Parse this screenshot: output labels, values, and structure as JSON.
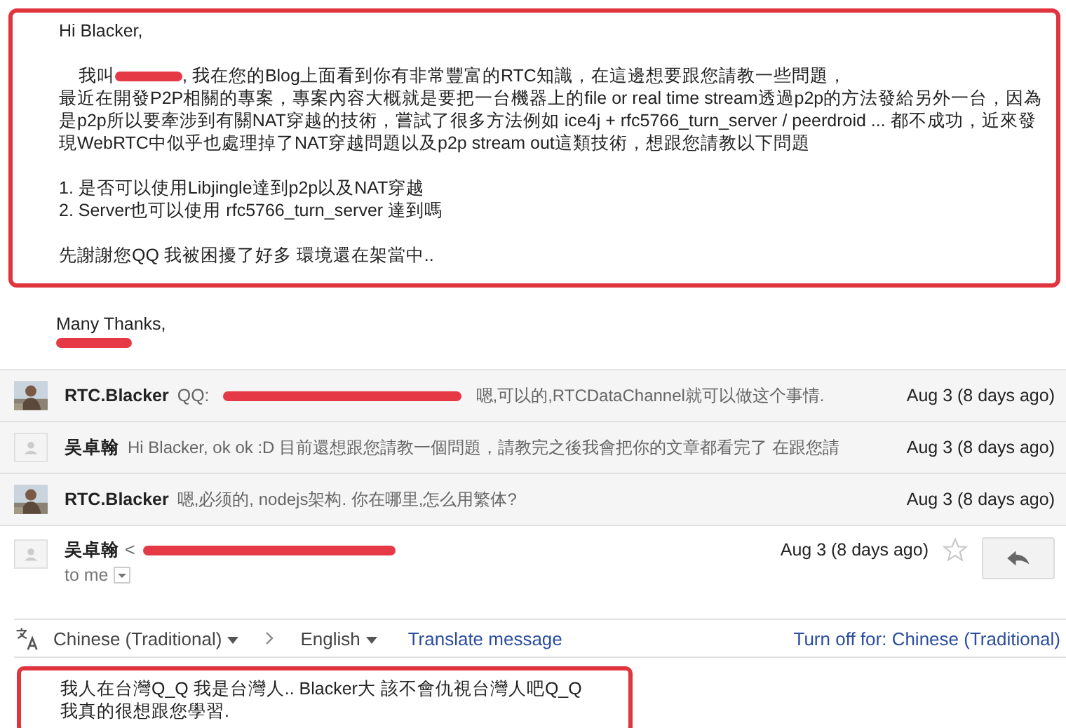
{
  "quoted_message": {
    "highlighted": true,
    "greeting": "Hi Blacker,",
    "intro_before": "我叫",
    "intro_redacted": true,
    "intro_after": ", 我在您的Blog上面看到你有非常豐富的RTC知識，在這邊想要跟您請教一些問題，",
    "paragraph": "最近在開發P2P相關的專案，專案內容大概就是要把一台機器上的file or real time stream透過p2p的方法發給另外一台，因為是p2p所以要牽涉到有關NAT穿越的技術，嘗試了很多方法例如 ice4j + rfc5766_turn_server / peerdroid ... 都不成功，近來發現WebRTC中似乎也處理掉了NAT穿越問題以及p2p stream out這類技術，想跟您請教以下問題",
    "questions": [
      "1. 是否可以使用Libjingle達到p2p以及NAT穿越",
      "2. Server也可以使用 rfc5766_turn_server 達到嗎"
    ],
    "closing": "先謝謝您QQ 我被困擾了好多 環境還在架當中.."
  },
  "signature": {
    "text": "Many Thanks,",
    "name_redacted": true
  },
  "thread": [
    {
      "sender": "RTC.Blacker",
      "snippet_before": "QQ:",
      "redacted": true,
      "snippet": "嗯,可以的,RTCDataChannel就可以做这个事情.",
      "date": "Aug 3 (8 days ago)"
    },
    {
      "kind": "blank",
      "sender": "吴卓翰",
      "redacted": false,
      "snippet": "Hi Blacker, ok ok :D 目前還想跟您請教一個問題，請教完之後我會把你的文章都看完了 在跟您請",
      "date": "Aug 3 (8 days ago)"
    },
    {
      "sender": "RTC.Blacker",
      "redacted": false,
      "snippet": "嗯,必须的, nodejs架构. 你在哪里,怎么用繁体?",
      "date": "Aug 3 (8 days ago)"
    }
  ],
  "open_message": {
    "sender": "吴卓翰",
    "address_before": "<",
    "address_redacted": true,
    "date": "Aug 3 (8 days ago)",
    "starred": false,
    "recipient": "to me",
    "translate_bar": {
      "from": "Chinese (Traditional)",
      "to": "English",
      "action": "Translate message",
      "turn_off": "Turn off for: Chinese (Traditional)"
    },
    "body": {
      "highlighted": true,
      "lines": [
        "我人在台灣Q_Q 我是台灣人.. Blacker大 該不會仇視台灣人吧Q_Q",
        "我真的很想跟您學習."
      ]
    }
  }
}
